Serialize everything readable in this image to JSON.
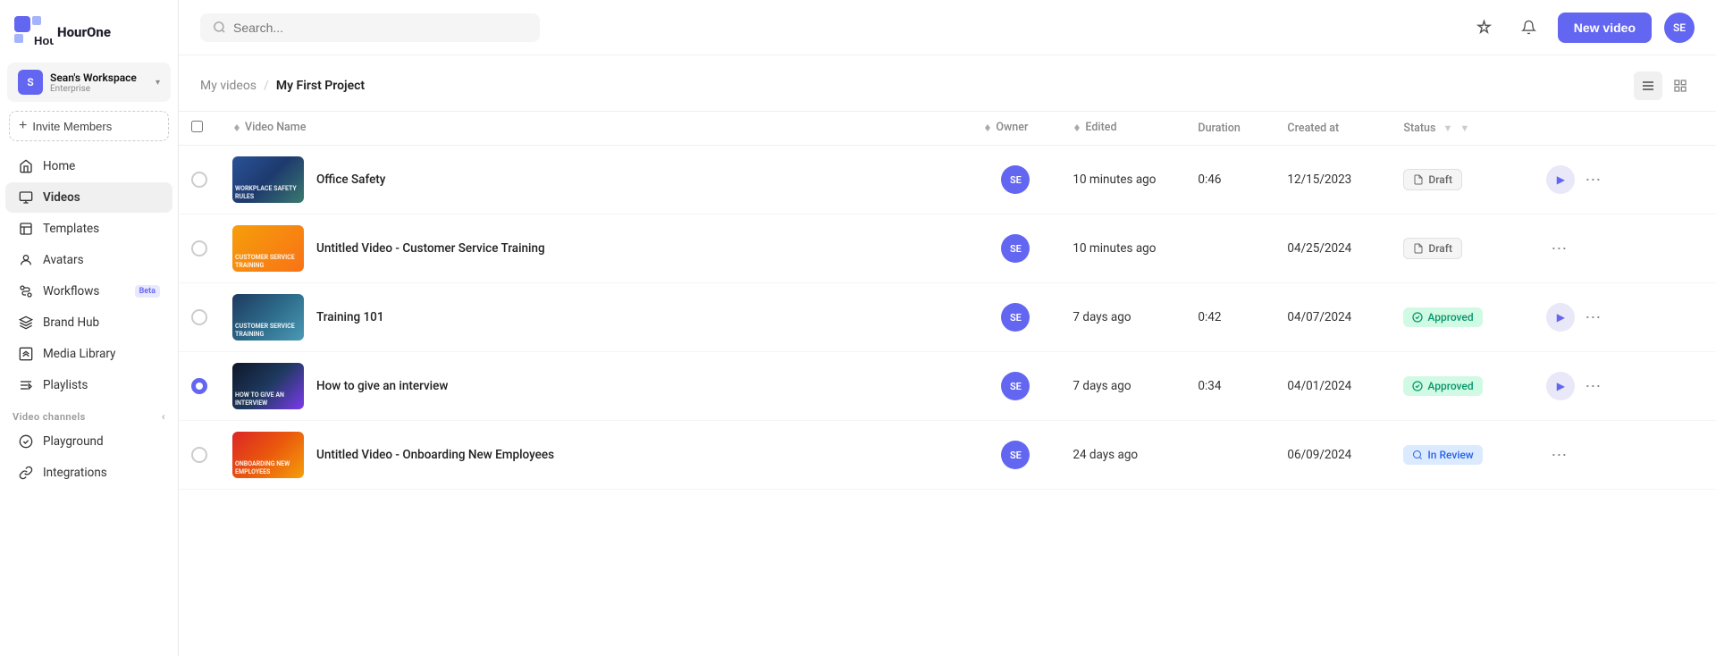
{
  "app": {
    "name": "HourOne"
  },
  "workspace": {
    "initials": "S",
    "name": "Sean's Workspace",
    "tier": "Enterprise"
  },
  "sidebar": {
    "invite_label": "Invite Members",
    "nav_items": [
      {
        "id": "home",
        "label": "Home",
        "icon": "home-icon",
        "active": false
      },
      {
        "id": "videos",
        "label": "Videos",
        "icon": "videos-icon",
        "active": true
      },
      {
        "id": "templates",
        "label": "Templates",
        "icon": "templates-icon",
        "active": false
      },
      {
        "id": "avatars",
        "label": "Avatars",
        "icon": "avatars-icon",
        "active": false
      },
      {
        "id": "workflows",
        "label": "Workflows",
        "icon": "workflows-icon",
        "active": false,
        "badge": "Beta"
      },
      {
        "id": "brand-hub",
        "label": "Brand Hub",
        "icon": "brand-hub-icon",
        "active": false
      },
      {
        "id": "media-library",
        "label": "Media Library",
        "icon": "media-library-icon",
        "active": false
      },
      {
        "id": "playlists",
        "label": "Playlists",
        "icon": "playlists-icon",
        "active": false
      }
    ],
    "video_channels_label": "Video channels",
    "bottom_items": [
      {
        "id": "playground",
        "label": "Playground",
        "icon": "playground-icon"
      },
      {
        "id": "integrations",
        "label": "Integrations",
        "icon": "integrations-icon"
      }
    ]
  },
  "header": {
    "search_placeholder": "Search...",
    "new_video_label": "New video",
    "user_initials": "SE"
  },
  "breadcrumb": {
    "root": "My videos",
    "separator": "/",
    "current": "My First Project"
  },
  "table": {
    "columns": [
      {
        "id": "name",
        "label": "Video Name",
        "sortable": true
      },
      {
        "id": "owner",
        "label": "Owner",
        "sortable": true
      },
      {
        "id": "edited",
        "label": "Edited",
        "sortable": true
      },
      {
        "id": "duration",
        "label": "Duration",
        "sortable": false
      },
      {
        "id": "created_at",
        "label": "Created at",
        "sortable": false
      },
      {
        "id": "status",
        "label": "Status",
        "sortable": false,
        "filterable": true
      }
    ],
    "rows": [
      {
        "id": 1,
        "thumb_class": "thumb-1",
        "thumb_label": "Workplace Safety Rules",
        "name": "Office Safety",
        "owner_initials": "SE",
        "edited": "10 minutes ago",
        "duration": "0:46",
        "created_at": "12/15/2023",
        "status": "Draft",
        "status_type": "draft",
        "has_play": true,
        "selected": false
      },
      {
        "id": 2,
        "thumb_class": "thumb-2",
        "thumb_label": "Customer Service Training",
        "name": "Untitled Video - Customer Service Training",
        "owner_initials": "SE",
        "edited": "10 minutes ago",
        "duration": "",
        "created_at": "04/25/2024",
        "status": "Draft",
        "status_type": "draft",
        "has_play": false,
        "selected": false
      },
      {
        "id": 3,
        "thumb_class": "thumb-3",
        "thumb_label": "Customer Service Training",
        "name": "Training 101",
        "owner_initials": "SE",
        "edited": "7 days ago",
        "duration": "0:42",
        "created_at": "04/07/2024",
        "status": "Approved",
        "status_type": "approved",
        "has_play": true,
        "selected": false
      },
      {
        "id": 4,
        "thumb_class": "thumb-4",
        "thumb_label": "How to give an interview",
        "name": "How to give an interview",
        "owner_initials": "SE",
        "edited": "7 days ago",
        "duration": "0:34",
        "created_at": "04/01/2024",
        "status": "Approved",
        "status_type": "approved",
        "has_play": true,
        "selected": true
      },
      {
        "id": 5,
        "thumb_class": "thumb-5",
        "thumb_label": "Onboarding New Employees",
        "name": "Untitled Video - Onboarding New Employees",
        "owner_initials": "SE",
        "edited": "24 days ago",
        "duration": "",
        "created_at": "06/09/2024",
        "status": "In Review",
        "status_type": "review",
        "has_play": false,
        "selected": false
      }
    ]
  }
}
